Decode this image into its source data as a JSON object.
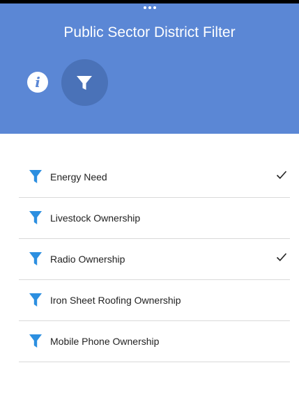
{
  "header": {
    "title": "Public Sector District Filter",
    "info_icon": "info-icon",
    "filter_icon": "filter-icon",
    "background_color": "#5b87d5"
  },
  "filters": [
    {
      "label": "Energy Need",
      "icon": "filter-icon",
      "checked": true
    },
    {
      "label": "Livestock Ownership",
      "icon": "filter-icon",
      "checked": false
    },
    {
      "label": "Radio Ownership",
      "icon": "filter-icon",
      "checked": true
    },
    {
      "label": "Iron Sheet Roofing Ownership",
      "icon": "filter-icon",
      "checked": false
    },
    {
      "label": "Mobile Phone Ownership",
      "icon": "filter-icon",
      "checked": false
    }
  ],
  "colors": {
    "accent": "#5b87d5",
    "filter_icon": "#2c8fe0",
    "active_button": "#4a72b8"
  }
}
